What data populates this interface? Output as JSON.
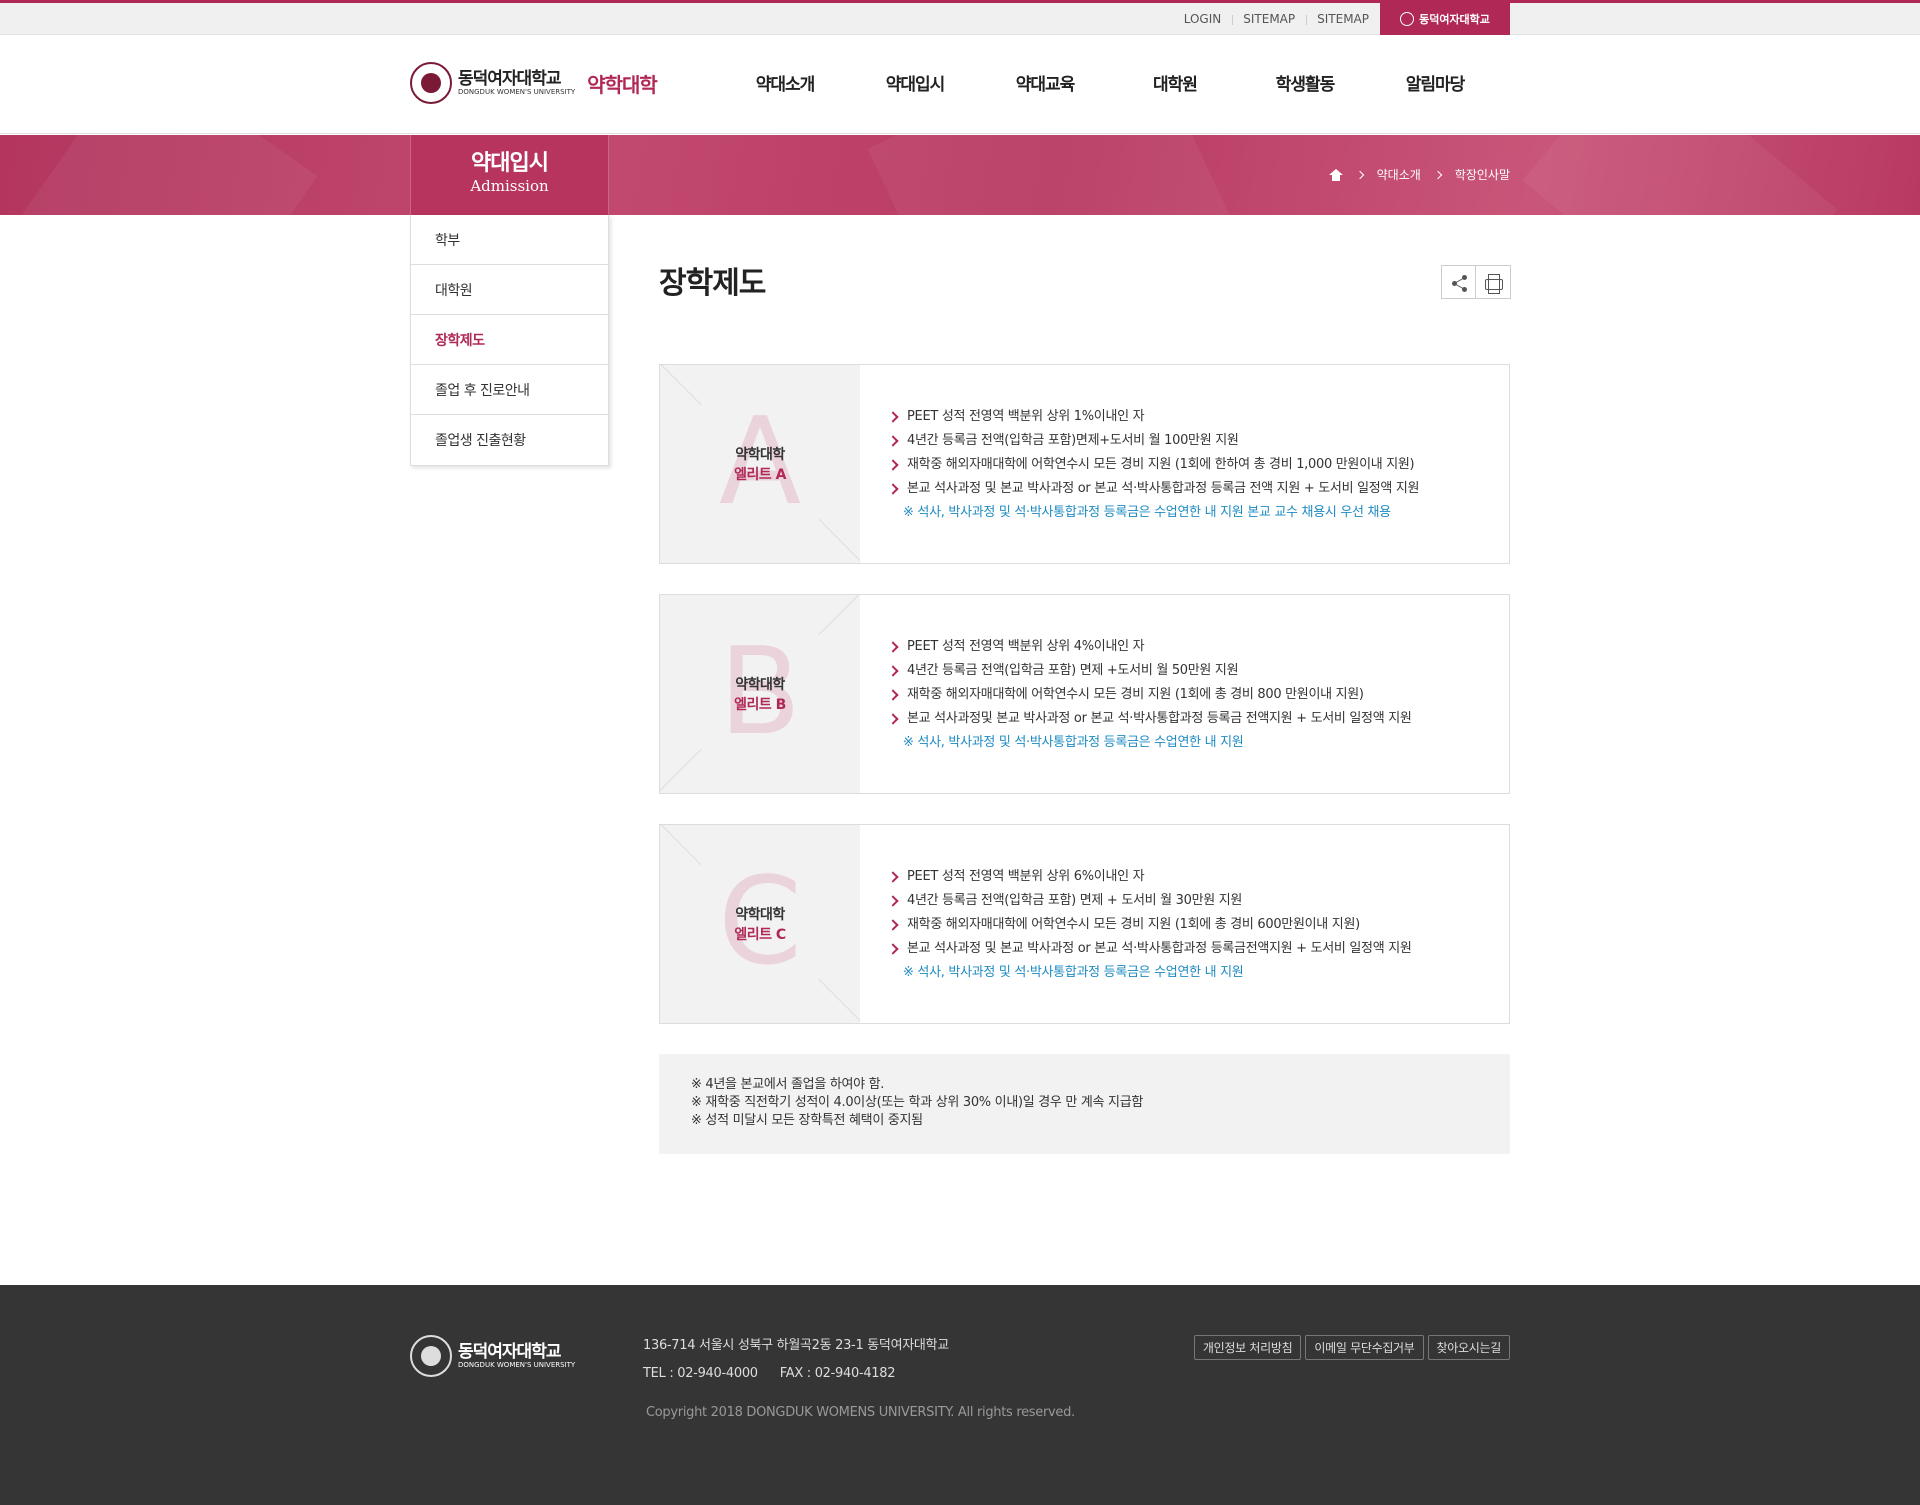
{
  "topbar": {
    "links": [
      "LOGIN",
      "SITEMAP",
      "SITEMAP"
    ],
    "univ_button": "동덕여자대학교"
  },
  "header": {
    "logo_ko": "동덕여자대학교",
    "logo_en": "DONGDUK WOMEN'S UNIVERSITY",
    "college": "약학대학",
    "menu": [
      "약대소개",
      "약대입시",
      "약대교육",
      "대학원",
      "학생활동",
      "알림마당"
    ]
  },
  "band": {
    "title_ko": "약대입시",
    "title_en": "Admission",
    "breadcrumb": [
      "약대소개",
      "학장인사말"
    ]
  },
  "lnb": {
    "items": [
      "학부",
      "대학원",
      "장학제도",
      "졸업 후 진로안내",
      "졸업생 진출현황"
    ],
    "active": "장학제도"
  },
  "page": {
    "title": "장학제도"
  },
  "scholarships": [
    {
      "letter": "A",
      "label1": "약학대학",
      "label2": "엘리트 A",
      "items": [
        "PEET 성적 전영역 백분위 상위 1%이내인 자",
        "4년간 등록금 전액(입학금 포함)면제+도서비 월 100만원 지원",
        "재학중 해외자매대학에 어학연수시 모든 경비 지원 (1회에 한하여 총 경비 1,000 만원이내 지원)",
        "본교 석사과정 및 본교 박사과정 or 본교 석·박사통합과정 등록금 전액 지원 + 도서비 일정액 지원"
      ],
      "note": "※ 석사, 박사과정 및 석·박사통합과정 등록금은 수업연한 내 지원 본교 교수 채용시 우선 채용"
    },
    {
      "letter": "B",
      "label1": "약학대학",
      "label2": "엘리트 B",
      "items": [
        "PEET 성적 전영역 백분위 상위 4%이내인 자",
        "4년간 등록금 전액(입학금 포함) 면제 +도서비 월 50만원 지원",
        "재학중 해외자매대학에 어학연수시 모든 경비 지원 (1회에 총 경비 800 만원이내 지원)",
        "본교 석사과정및 본교 박사과정 or 본교 석·박사통합과정 등록금 전액지원 + 도서비 일정액 지원"
      ],
      "note": "※ 석사, 박사과정 및 석·박사통합과정 등록금은 수업연한 내 지원"
    },
    {
      "letter": "C",
      "label1": "약학대학",
      "label2": "엘리트 C",
      "items": [
        "PEET 성적 전영역 백분위 상위 6%이내인 자",
        "4년간 등록금 전액(입학금 포함) 면제 + 도서비 월 30만원 지원",
        "재학중 해외자매대학에 어학연수시 모든 경비 지원 (1회에 총 경비 600만원이내 지원)",
        "본교 석사과정 및 본교 박사과정 or 본교 석·박사통합과정 등록금전액지원 + 도서비 일정액 지원"
      ],
      "note": "※ 석사, 박사과정 및 석·박사통합과정 등록금은 수업연한 내 지원"
    }
  ],
  "notice": [
    "※ 4년을 본교에서 졸업을 하여야 함.",
    "※ 재학중 직전학기 성적이 4.0이상(또는 학과 상위 30% 이내)일 경우 만 계속 지급함",
    "※ 성적 미달시 모든 장학특전 혜택이 중지됨"
  ],
  "footer": {
    "logo_ko": "동덕여자대학교",
    "logo_en": "DONGDUK WOMEN'S UNIVERSITY",
    "address": "136-714 서울시 성북구 하월곡2동 23-1 동덕여자대학교",
    "tel": "TEL : 02-940-4000",
    "fax": "FAX : 02-940-4182",
    "copyright": "Copyright 2018 DONGDUK WOMENS UNIVERSITY. All rights reserved.",
    "links": [
      "개인정보 처리방침",
      "이메일 무단수집거부",
      "찾아오시는길"
    ]
  },
  "colors": {
    "brand": "#b02856",
    "note_blue": "#1e8bc3",
    "footer_bg": "#353535"
  }
}
